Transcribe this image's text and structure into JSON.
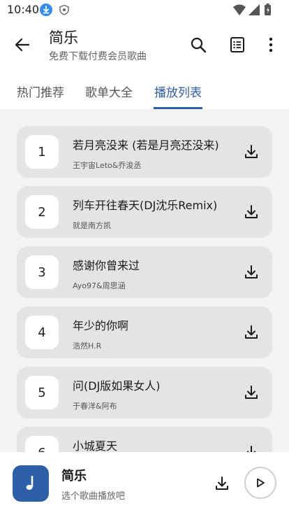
{
  "status_bar": {
    "time": "10:40"
  },
  "app_bar": {
    "title": "简乐",
    "subtitle": "免费下载付费会员歌曲"
  },
  "tabs": [
    {
      "label": "热门推荐",
      "active": false
    },
    {
      "label": "歌单大全",
      "active": false
    },
    {
      "label": "播放列表",
      "active": true
    }
  ],
  "songs": [
    {
      "index": "1",
      "title": "若月亮没来 (若是月亮还没来)",
      "artist": "王宇宙Leto&乔浚丞"
    },
    {
      "index": "2",
      "title": "列车开往春天(DJ沈乐Remix)",
      "artist": "就是南方凯"
    },
    {
      "index": "3",
      "title": "感谢你曾来过",
      "artist": "Ayo97&周思涵"
    },
    {
      "index": "4",
      "title": "年少的你啊",
      "artist": "浩然H.R"
    },
    {
      "index": "5",
      "title": "问(DJ版如果女人)",
      "artist": "于春洋&阿布"
    },
    {
      "index": "6",
      "title": "小城夏天",
      "artist": ""
    }
  ],
  "player": {
    "title": "简乐",
    "subtitle": "选个歌曲播放吧"
  },
  "colors": {
    "accent": "#2d5ea8",
    "card": "#e4e4e4",
    "background": "#f3f3f3"
  }
}
